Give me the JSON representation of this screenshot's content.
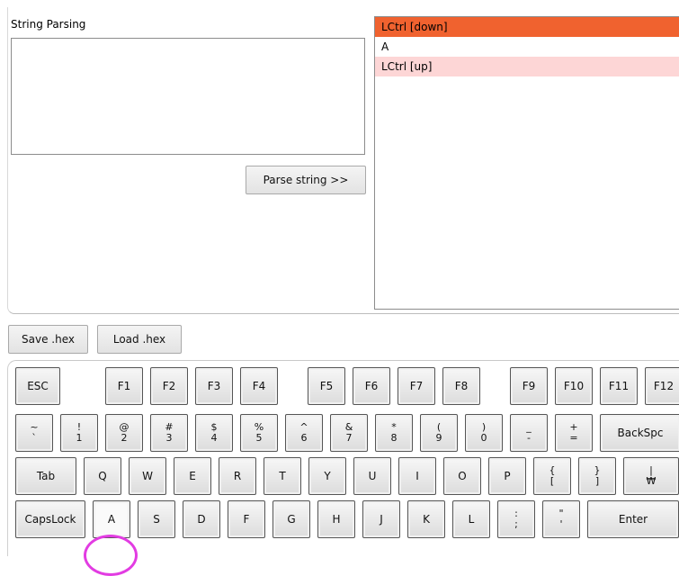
{
  "string_parsing": {
    "title": "String Parsing",
    "input_value": "",
    "parse_button": "Parse string >>"
  },
  "events": [
    {
      "label": "LCtrl [down]",
      "state": "selected"
    },
    {
      "label": "A",
      "state": "normal"
    },
    {
      "label": "LCtrl [up]",
      "state": "up"
    }
  ],
  "file_buttons": {
    "save": "Save .hex",
    "load": "Load .hex"
  },
  "keyboard": {
    "fn_row": [
      "ESC",
      "F1",
      "F2",
      "F3",
      "F4",
      "F5",
      "F6",
      "F7",
      "F8",
      "F9",
      "F10",
      "F11",
      "F12"
    ],
    "number_row": [
      {
        "top": "~",
        "bottom": "`"
      },
      {
        "top": "!",
        "bottom": "1"
      },
      {
        "top": "@",
        "bottom": "2"
      },
      {
        "top": "#",
        "bottom": "3"
      },
      {
        "top": "$",
        "bottom": "4"
      },
      {
        "top": "%",
        "bottom": "5"
      },
      {
        "top": "^",
        "bottom": "6"
      },
      {
        "top": "&",
        "bottom": "7"
      },
      {
        "top": "*",
        "bottom": "8"
      },
      {
        "top": "(",
        "bottom": "9"
      },
      {
        "top": ")",
        "bottom": "0"
      },
      {
        "top": "_",
        "bottom": "-"
      },
      {
        "top": "+",
        "bottom": "="
      },
      {
        "top": "BackSpc",
        "bottom": ""
      }
    ],
    "tab_row": [
      {
        "top": "Tab",
        "bottom": ""
      },
      {
        "top": "Q",
        "bottom": ""
      },
      {
        "top": "W",
        "bottom": ""
      },
      {
        "top": "E",
        "bottom": ""
      },
      {
        "top": "R",
        "bottom": ""
      },
      {
        "top": "T",
        "bottom": ""
      },
      {
        "top": "Y",
        "bottom": ""
      },
      {
        "top": "U",
        "bottom": ""
      },
      {
        "top": "I",
        "bottom": ""
      },
      {
        "top": "O",
        "bottom": ""
      },
      {
        "top": "P",
        "bottom": ""
      },
      {
        "top": "{",
        "bottom": "["
      },
      {
        "top": "}",
        "bottom": "]"
      },
      {
        "top": "|",
        "bottom": "₩"
      }
    ],
    "caps_row": [
      {
        "top": "CapsLock",
        "bottom": ""
      },
      {
        "top": "A",
        "bottom": ""
      },
      {
        "top": "S",
        "bottom": ""
      },
      {
        "top": "D",
        "bottom": ""
      },
      {
        "top": "F",
        "bottom": ""
      },
      {
        "top": "G",
        "bottom": ""
      },
      {
        "top": "H",
        "bottom": ""
      },
      {
        "top": "J",
        "bottom": ""
      },
      {
        "top": "K",
        "bottom": ""
      },
      {
        "top": "L",
        "bottom": ""
      },
      {
        "top": ":",
        "bottom": ";"
      },
      {
        "top": "\"",
        "bottom": "'"
      },
      {
        "top": "Enter",
        "bottom": ""
      }
    ],
    "highlighted_key": "A",
    "highlight_color": "#e23ce2"
  },
  "colors": {
    "selected_event": "#f0622f",
    "up_event": "#fdd6d6"
  }
}
